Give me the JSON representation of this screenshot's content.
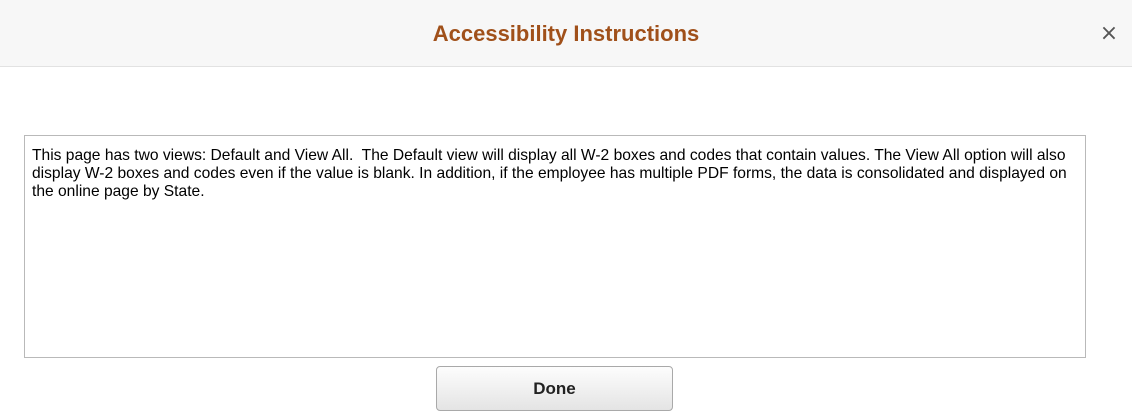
{
  "dialog": {
    "title": "Accessibility Instructions",
    "close_glyph": "×",
    "close_icon": "close-icon"
  },
  "instructions": {
    "text": "This page has two views: Default and View All.  The Default view will display all W-2 boxes and codes that contain values. The View All option will also display W-2 boxes and codes even if the value is blank. In addition, if the employee has multiple PDF forms, the data is consolidated and displayed on the online page by State."
  },
  "footer": {
    "done_label": "Done"
  },
  "colors": {
    "title": "#a0501a",
    "header_bg": "#f7f7f7"
  }
}
